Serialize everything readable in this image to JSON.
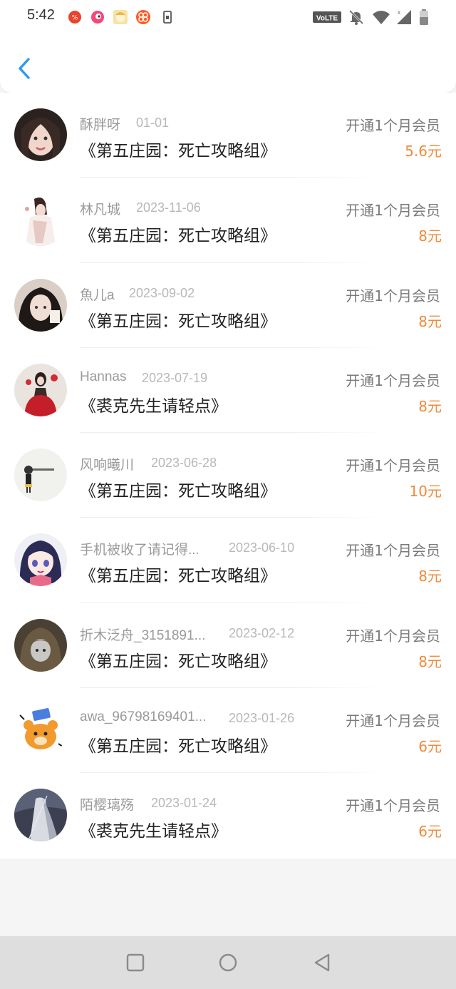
{
  "status_bar": {
    "time": "5:42",
    "volte_label": "VoLTE"
  },
  "header": {
    "back_icon": "chevron-left-icon"
  },
  "records": [
    {
      "name": "酥胖呀",
      "date": "01-01",
      "title": "《第五庄园：死亡攻略组》",
      "action": "开通1个月会员",
      "price": "5.6元"
    },
    {
      "name": "林凡城",
      "date": "2023-11-06",
      "title": "《第五庄园：死亡攻略组》",
      "action": "开通1个月会员",
      "price": "8元"
    },
    {
      "name": "魚儿a",
      "date": "2023-09-02",
      "title": "《第五庄园：死亡攻略组》",
      "action": "开通1个月会员",
      "price": "8元"
    },
    {
      "name": "Hannas",
      "date": "2023-07-19",
      "title": "《裘克先生请轻点》",
      "action": "开通1个月会员",
      "price": "8元"
    },
    {
      "name": "风响曦川",
      "date": "2023-06-28",
      "title": "《第五庄园：死亡攻略组》",
      "action": "开通1个月会员",
      "price": "10元"
    },
    {
      "name": "手机被收了请记得...",
      "date": "2023-06-10",
      "title": "《第五庄园：死亡攻略组》",
      "action": "开通1个月会员",
      "price": "8元"
    },
    {
      "name": "折木泛舟_3151891...",
      "date": "2023-02-12",
      "title": "《第五庄园：死亡攻略组》",
      "action": "开通1个月会员",
      "price": "8元"
    },
    {
      "name": "awa_96798169401...",
      "date": "2023-01-26",
      "title": "《第五庄园：死亡攻略组》",
      "action": "开通1个月会员",
      "price": "6元"
    },
    {
      "name": "陌樱璃殇",
      "date": "2023-01-24",
      "title": "《裘克先生请轻点》",
      "action": "开通1个月会员",
      "price": "6元"
    }
  ],
  "colors": {
    "accent_blue": "#2a9af3",
    "price_orange": "#f08a3a",
    "nav_bar": "#dedede"
  }
}
